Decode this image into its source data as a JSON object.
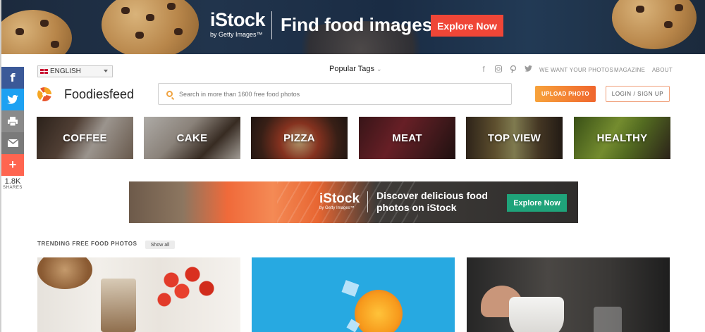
{
  "top_banner": {
    "logo": "iStock",
    "logo_sub": "by Getty Images™",
    "headline": "Find food images",
    "cta": "Explore Now",
    "cta_color": "#ef4637"
  },
  "share_bar": {
    "buttons": [
      {
        "name": "facebook",
        "icon": "f",
        "color": "#3b5998"
      },
      {
        "name": "twitter",
        "icon": "🐦",
        "color": "#1da1f2"
      },
      {
        "name": "print",
        "icon": "⎙",
        "color": "#8a8a8a"
      },
      {
        "name": "email",
        "icon": "✉",
        "color": "#7a7a7a"
      },
      {
        "name": "more",
        "icon": "+",
        "color": "#ff6550"
      }
    ],
    "count": "1.8K",
    "label": "SHARES"
  },
  "header": {
    "language": "ENGLISH",
    "popular_tags": "Popular Tags",
    "top_links": [
      "WE WANT YOUR PHOTOS",
      "MAGAZINE",
      "ABOUT"
    ],
    "site_name": "Foodiesfeed",
    "search_placeholder": "Search in more than 1600 free food photos",
    "upload_label": "UPLOAD PHOTO",
    "login_label": "LOGIN / SIGN UP"
  },
  "categories": [
    "COFFEE",
    "CAKE",
    "PIZZA",
    "MEAT",
    "TOP VIEW",
    "HEALTHY"
  ],
  "mid_banner": {
    "logo": "iStock",
    "logo_sub": "by Getty Images™",
    "headline": "Discover delicious food photos on iStock",
    "cta": "Explore Now",
    "cta_color": "#1fa37a"
  },
  "trending": {
    "title": "TRENDING FREE FOOD PHOTOS",
    "show_all": "Show all"
  }
}
